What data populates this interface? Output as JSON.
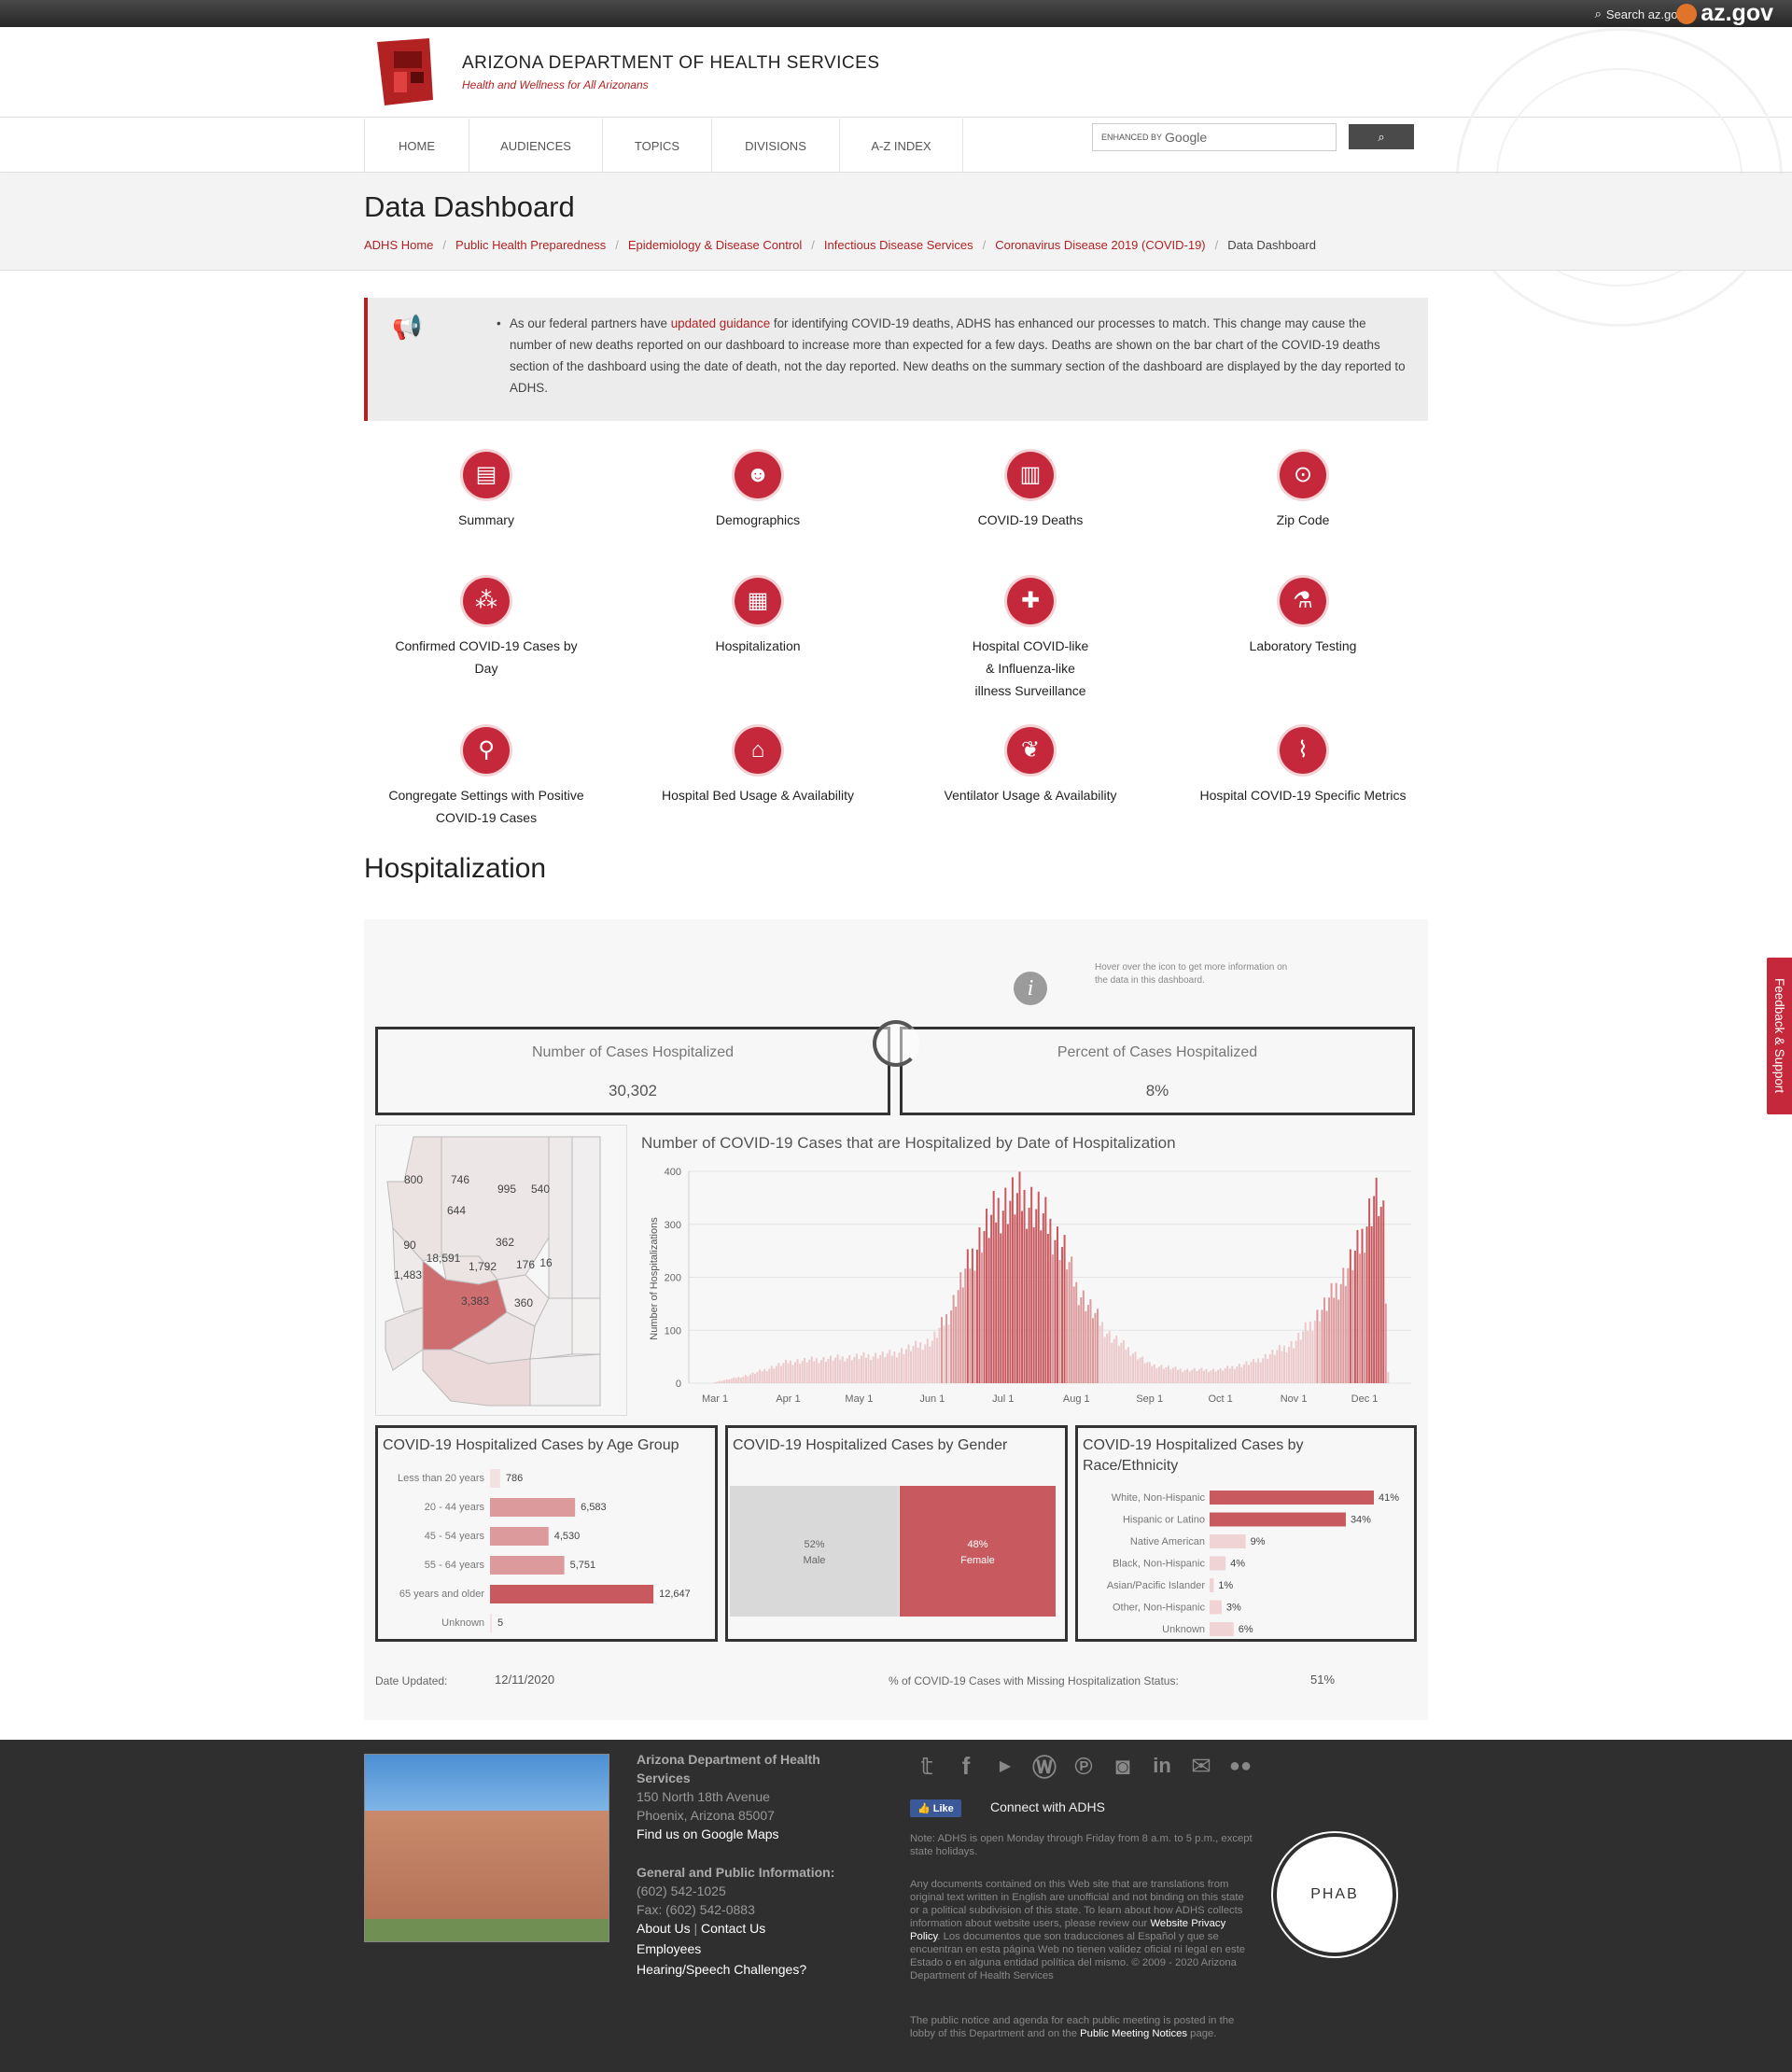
{
  "topbar": {
    "search": "Search az.gov",
    "brand": "az.gov"
  },
  "header": {
    "agency": "ARIZONA DEPARTMENT OF HEALTH SERVICES",
    "tagline": "Health and Wellness for All Arizonans"
  },
  "nav": {
    "items": [
      "HOME",
      "AUDIENCES",
      "TOPICS",
      "DIVISIONS",
      "A-Z INDEX"
    ],
    "search_enhanced": "ENHANCED BY",
    "search_brand": "Google"
  },
  "page": {
    "title": "Data Dashboard",
    "breadcrumbs": [
      "ADHS Home",
      "Public Health Preparedness",
      "Epidemiology & Disease Control",
      "Infectious Disease Services",
      "Coronavirus Disease 2019 (COVID-19)"
    ],
    "breadcrumb_current": "Data Dashboard"
  },
  "notice": {
    "pre": "As our federal partners have ",
    "link": "updated guidance",
    "post": " for identifying COVID-19 deaths, ADHS has enhanced our processes to match. This change may cause the number of new deaths reported on our dashboard to increase more than expected for a few days. Deaths are shown on the bar chart of the COVID-19 deaths section of the dashboard using the date of death, not the day reported. New deaths on the summary section of the dashboard are displayed by the day reported to ADHS."
  },
  "tiles": [
    {
      "label": "Summary",
      "icon": "document-icon",
      "glyph": "▤"
    },
    {
      "label": "Demographics",
      "icon": "people-icon",
      "glyph": "☻"
    },
    {
      "label": "COVID-19 Deaths",
      "icon": "bar-chart-icon",
      "glyph": "▥"
    },
    {
      "label": "Zip Code",
      "icon": "map-pin-icon",
      "glyph": "⊙"
    },
    {
      "label": "Confirmed COVID-19 Cases by Day",
      "icon": "network-icon",
      "glyph": "⁂"
    },
    {
      "label": "Hospitalization",
      "icon": "hospital-beds-icon",
      "glyph": "▦"
    },
    {
      "label": "Hospital COVID-like & Influenza-like illness Surveillance",
      "icon": "hospital-building-icon",
      "glyph": "✚"
    },
    {
      "label": "Laboratory Testing",
      "icon": "test-tubes-icon",
      "glyph": "⚗"
    },
    {
      "label": "Congregate Settings with Positive COVID-19 Cases",
      "icon": "microscope-icon",
      "glyph": "⚲"
    },
    {
      "label": "Hospital Bed Usage & Availability",
      "icon": "bed-icon",
      "glyph": "⌂"
    },
    {
      "label": "Ventilator Usage & Availability",
      "icon": "lungs-icon",
      "glyph": "❦"
    },
    {
      "label": "Hospital COVID-19 Specific Metrics",
      "icon": "line-chart-icon",
      "glyph": "⌇"
    }
  ],
  "section": {
    "title": "Hospitalization"
  },
  "dashboard": {
    "hover_text": "Hover over the icon to get more information on the data in this dashboard.",
    "info_glyph": "i",
    "kpis": [
      {
        "label": "Number of Cases Hospitalized",
        "value": "30,302"
      },
      {
        "label": "Percent of Cases Hospitalized",
        "value": "8%"
      }
    ],
    "map_labels": [
      "800",
      "746",
      "995",
      "540",
      "644",
      "90",
      "18,591",
      "362",
      "1,792",
      "176",
      "16",
      "1,483",
      "3,383",
      "360"
    ],
    "date_label": "Date Updated:",
    "date_value": "12/11/2020",
    "missing_label": "% of COVID-19 Cases with Missing Hospitalization Status:",
    "missing_value": "51%"
  },
  "chart_data": [
    {
      "type": "bar",
      "title": "Number of COVID-19 Cases that are Hospitalized by Date of Hospitalization",
      "xlabel": "",
      "ylabel": "Number of Hospitalizations",
      "ylim": [
        0,
        400
      ],
      "yticks": [
        0,
        100,
        200,
        300,
        400
      ],
      "xticks": [
        "Mar 1",
        "Apr 1",
        "May 1",
        "Jun 1",
        "Jul 1",
        "Aug 1",
        "Sep 1",
        "Oct 1",
        "Nov 1",
        "Dec 1"
      ],
      "x": [
        "Mar 1",
        "Mar 15",
        "Apr 1",
        "Apr 15",
        "May 1",
        "May 15",
        "Jun 1",
        "Jun 8",
        "Jun 15",
        "Jun 22",
        "Jun 29",
        "Jul 6",
        "Jul 13",
        "Jul 20",
        "Jul 27",
        "Aug 1",
        "Aug 15",
        "Sep 1",
        "Sep 15",
        "Oct 1",
        "Oct 15",
        "Nov 1",
        "Nov 8",
        "Nov 15",
        "Nov 22",
        "Nov 29",
        "Dec 3",
        "Dec 6",
        "Dec 9",
        "Dec 11"
      ],
      "values": [
        2,
        15,
        40,
        45,
        50,
        55,
        80,
        130,
        210,
        280,
        330,
        350,
        340,
        300,
        250,
        180,
        90,
        35,
        25,
        25,
        40,
        75,
        110,
        150,
        200,
        260,
        320,
        370,
        300,
        20
      ]
    },
    {
      "type": "bar",
      "title": "COVID-19 Hospitalized Cases by Age Group",
      "categories": [
        "Less than 20 years",
        "20 - 44 years",
        "45 - 54 years",
        "55 - 64 years",
        "65 years and older",
        "Unknown"
      ],
      "values": [
        786,
        6583,
        4530,
        5751,
        12647,
        5
      ],
      "labels": [
        "786",
        "6,583",
        "4,530",
        "5,751",
        "12,647",
        "5"
      ]
    },
    {
      "type": "bar",
      "title": "COVID-19 Hospitalized Cases by Gender",
      "categories": [
        "Male",
        "Female"
      ],
      "values": [
        52,
        48
      ],
      "labels": [
        "52%",
        "48%"
      ]
    },
    {
      "type": "bar",
      "title": "COVID-19 Hospitalized Cases by Race/Ethnicity",
      "categories": [
        "White, Non-Hispanic",
        "Hispanic or Latino",
        "Native American",
        "Black, Non-Hispanic",
        "Asian/Pacific Islander",
        "Other, Non-Hispanic",
        "Unknown"
      ],
      "values": [
        41,
        34,
        9,
        4,
        1,
        3,
        6
      ],
      "labels": [
        "41%",
        "34%",
        "9%",
        "4%",
        "1%",
        "3%",
        "6%"
      ]
    }
  ],
  "footer": {
    "org": "Arizona Department of Health Services",
    "addr1": "150 North 18th Avenue",
    "addr2": "Phoenix, Arizona 85007",
    "maps": "Find us on Google Maps",
    "gen": "General and Public Information:",
    "phone": "(602) 542-1025",
    "fax": "Fax: (602) 542-0883",
    "about": "About Us",
    "contact": "Contact Us",
    "employees": "Employees",
    "hearing": "Hearing/Speech Challenges?",
    "like": "Like",
    "connect": "Connect with ADHS",
    "note1": "Note: ADHS is open Monday through Friday from 8 a.m. to 5 p.m., except state holidays.",
    "note2a": "Any documents contained on this Web site that are translations from original text written in English are unofficial and not binding on this state or a political subdivision of this state. To learn about how ADHS collects information about website users, please review our ",
    "note2link": "Website Privacy Policy",
    "note2b": ". Los documentos que son traducciones al Español y que se encuentran en esta página Web no tienen validez oficial ni legal en este Estado o en alguna entidad política del mismo. © 2009 - 2020 Arizona Department of Health Services",
    "note3a": "The public notice and agenda for each public meeting is posted in the lobby of this Department and on the ",
    "note3link": "Public Meeting Notices",
    "note3b": " page.",
    "phab": "PHAB"
  },
  "feedback": "Feedback & Support",
  "colors": {
    "accent": "#b22222",
    "icon_bg": "#c5283a",
    "bar_dark": "#c85a5f",
    "bar_mid": "#dc9a9c",
    "bar_light": "#f0d4d5",
    "dark_footer": "#2f2f2f"
  }
}
